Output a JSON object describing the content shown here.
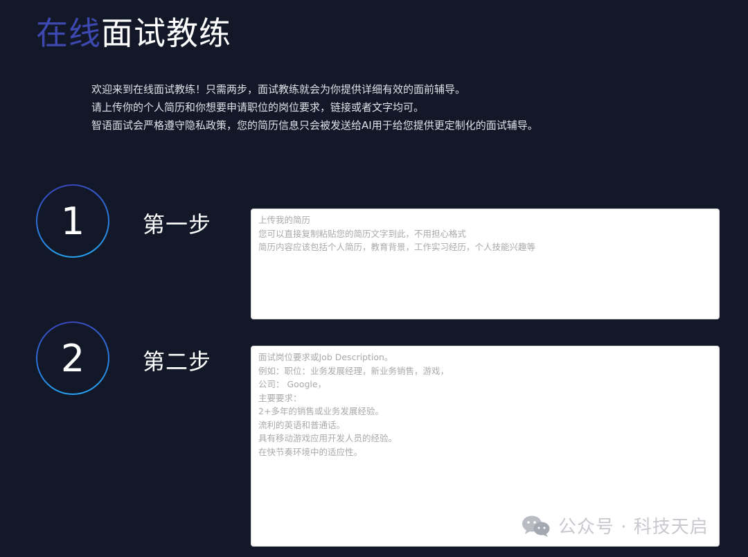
{
  "header": {
    "title_accent": "在线",
    "title_rest": "面试教练"
  },
  "intro": {
    "lines": [
      "欢迎来到在线面试教练！只需两步，面试教练就会为你提供详细有效的面前辅导。",
      "请上传你的个人简历和你想要申请职位的岗位要求，链接或者文字均可。",
      "智语面试会严格遵守隐私政策，您的简历信息只会被发送给AI用于给您提供更定制化的面试辅导。"
    ]
  },
  "steps": [
    {
      "number": "1",
      "label": "第一步",
      "placeholder_lines": [
        "上传我的简历",
        "您可以直接复制粘贴您的简历文字到此，不用担心格式",
        "简历内容应该包括个人简历，教育背景，工作实习经历，个人技能兴趣等"
      ]
    },
    {
      "number": "2",
      "label": "第二步",
      "placeholder_lines": [
        "面试岗位要求或Job Description。",
        "例如：职位：业务发展经理，新业务销售，游戏，",
        "公司： Google，",
        "主要要求：",
        "2+多年的销售或业务发展经验。",
        "流利的英语和普通话。",
        "具有移动游戏应用开发人员的经验。",
        "在快节奏环境中的适应性。"
      ]
    }
  ],
  "watermark": {
    "text": "公众号 · 科技天启",
    "icon": "wechat-icon"
  },
  "colors": {
    "background": "#121827",
    "accent": "#3d48b0",
    "circle_gradient_start": "#3b3fb6",
    "circle_gradient_end": "#27a9f2"
  }
}
